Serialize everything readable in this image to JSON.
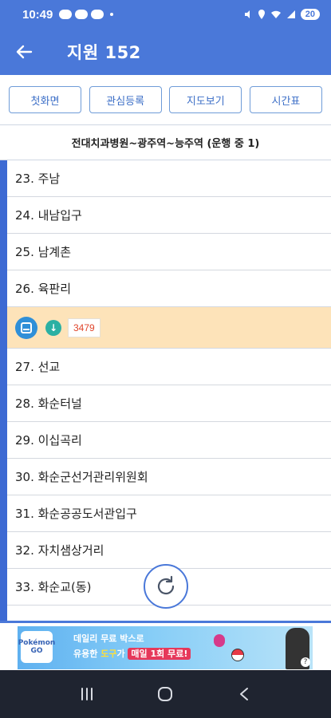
{
  "status_bar": {
    "time": "10:49",
    "battery": "20"
  },
  "app_bar": {
    "title": "지원 152"
  },
  "buttons": [
    {
      "label": "첫화면"
    },
    {
      "label": "관심등록"
    },
    {
      "label": "지도보기"
    },
    {
      "label": "시간표"
    }
  ],
  "route_header": "전대치과병원~광주역~능주역 (운행 중 1)",
  "stops": [
    "23. 주남",
    "24. 내남입구",
    "25. 남계촌",
    "26. 육판리",
    "27. 선교",
    "28. 화순터널",
    "29. 이십곡리",
    "30. 화순군선거관리위원회",
    "31. 화순공공도서관입구",
    "32. 자치샘상거리",
    "33. 화순교(동)"
  ],
  "bus": {
    "plate": "3479"
  },
  "ad": {
    "logo": "Pokémon GO",
    "line1": "데일리 무료 박스로",
    "line2_prefix": "유용한 ",
    "line2_tool": "도구",
    "line2_mid": "가 ",
    "line2_highlight": "매일 1회 무료!"
  },
  "colors": {
    "primary": "#4a78d9",
    "bus_row": "#fde3b9",
    "plate_text": "#e0452b"
  },
  "icons": [
    "back-arrow-icon",
    "bus-icon",
    "down-arrow-icon",
    "refresh-icon",
    "recents-icon",
    "home-icon",
    "back-nav-icon"
  ]
}
